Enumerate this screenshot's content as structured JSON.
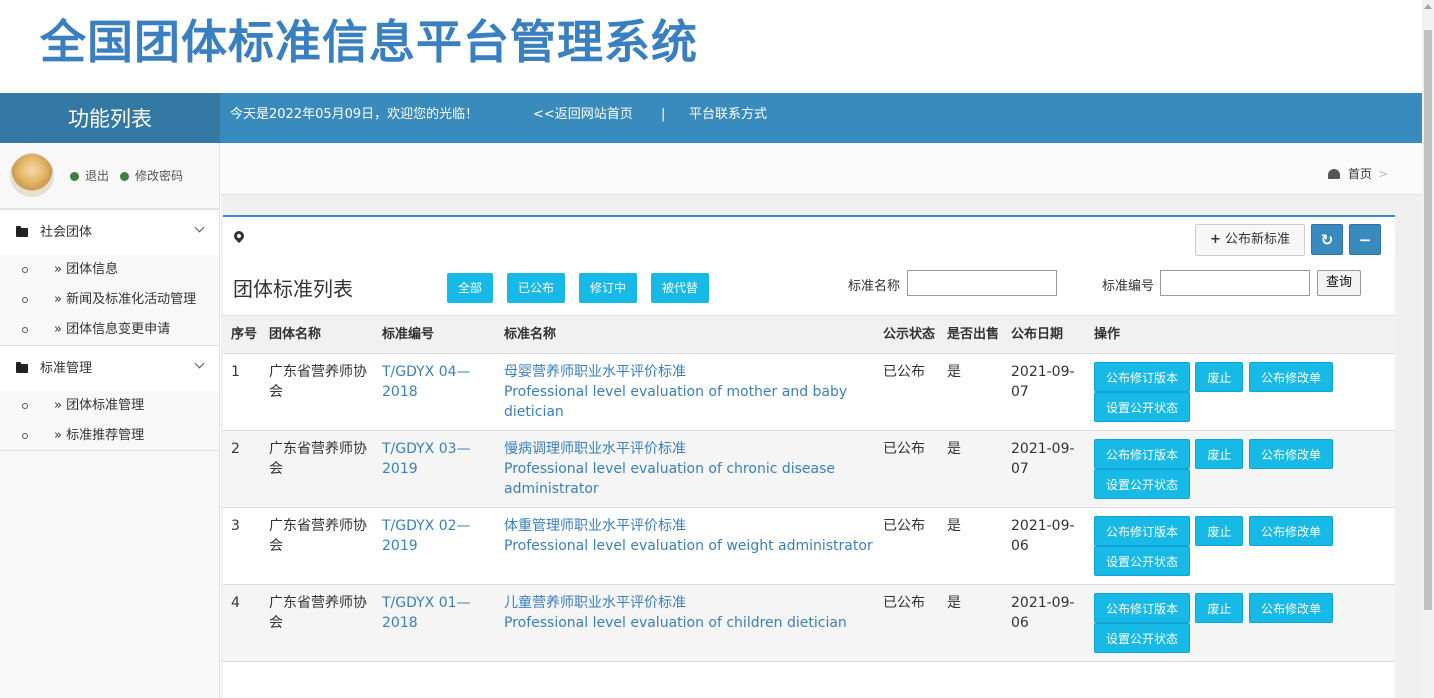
{
  "header": {
    "title": "全国团体标准信息平台管理系统"
  },
  "nav": {
    "left_title": "功能列表",
    "welcome": "今天是2022年05月09日，欢迎您的光临！",
    "home_link": "<<返回网站首页",
    "separator": "|",
    "contact_link": "平台联系方式"
  },
  "user": {
    "logout": "退出",
    "change_password": "修改密码"
  },
  "sidebar": {
    "groups": [
      {
        "label": "社会团体",
        "items": [
          "» 团体信息",
          "» 新闻及标准化活动管理",
          "» 团体信息变更申请"
        ]
      },
      {
        "label": "标准管理",
        "items": [
          "» 团体标准管理",
          "» 标准推荐管理"
        ]
      }
    ]
  },
  "breadcrumb": {
    "home": "首页",
    "sep": ">"
  },
  "toolbar": {
    "publish_new": "公布新标准",
    "refresh_icon": "refresh-icon",
    "collapse_icon": "minus-icon"
  },
  "list": {
    "title": "团体标准列表",
    "filters": [
      "全部",
      "已公布",
      "修订中",
      "被代替"
    ],
    "search": {
      "name_label": "标准名称",
      "name_value": "",
      "code_label": "标准编号",
      "code_value": "",
      "query_button": "查询"
    },
    "columns": [
      "序号",
      "团体名称",
      "标准编号",
      "标准名称",
      "公示状态",
      "是否出售",
      "公布日期",
      "操作"
    ],
    "rows": [
      {
        "no": "1",
        "org": "广东省营养师协会",
        "code": "T/GDYX 04—2018",
        "name_cn": "母婴营养师职业水平评价标准",
        "name_en": "Professional level evaluation of mother and baby dietician",
        "status": "已公布",
        "sale": "是",
        "date": "2021-09-07"
      },
      {
        "no": "2",
        "org": "广东省营养师协会",
        "code": "T/GDYX 03—2019",
        "name_cn": "慢病调理师职业水平评价标准",
        "name_en": "Professional level evaluation of chronic disease administrator",
        "status": "已公布",
        "sale": "是",
        "date": "2021-09-07"
      },
      {
        "no": "3",
        "org": "广东省营养师协会",
        "code": "T/GDYX 02—2019",
        "name_cn": "体重管理师职业水平评价标准",
        "name_en": "Professional level evaluation of weight administrator",
        "status": "已公布",
        "sale": "是",
        "date": "2021-09-06"
      },
      {
        "no": "4",
        "org": "广东省营养师协会",
        "code": "T/GDYX 01—2018",
        "name_cn": "儿童营养师职业水平评价标准",
        "name_en": "Professional level evaluation of children dietician",
        "status": "已公布",
        "sale": "是",
        "date": "2021-09-06"
      }
    ],
    "actions": [
      "公布修订版本",
      "废止",
      "公布修改单",
      "设置公开状态"
    ]
  },
  "colors": {
    "primary": "#3a8bbd",
    "action": "#17b9e6",
    "title": "#3a7fbf"
  }
}
